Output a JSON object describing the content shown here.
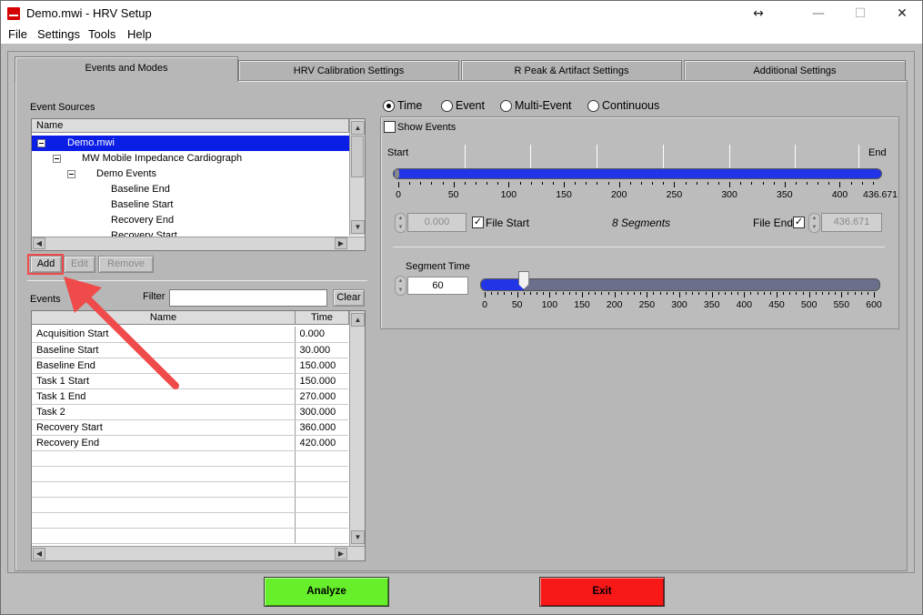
{
  "window": {
    "title": "Demo.mwi - HRV Setup",
    "resize_glyph": "↔",
    "min_glyph": "—",
    "max_glyph": "☐",
    "close_glyph": "✕"
  },
  "menu": [
    "File",
    "Settings",
    "Tools",
    "Help"
  ],
  "tabs": [
    "Events and Modes",
    "HRV Calibration Settings",
    "R Peak & Artifact Settings",
    "Additional Settings"
  ],
  "event_sources": {
    "label": "Event Sources",
    "column": "Name",
    "items": [
      "Demo.mwi",
      "MW Mobile Impedance Cardiograph",
      "Demo Events",
      "Baseline End",
      "Baseline Start",
      "Recovery End",
      "Recovery Start"
    ]
  },
  "source_buttons": {
    "add": "Add",
    "edit": "Edit",
    "remove": "Remove"
  },
  "events": {
    "label": "Events",
    "filter_label": "Filter",
    "filter_value": "",
    "clear": "Clear",
    "columns": [
      "Name",
      "Time"
    ],
    "rows": [
      [
        "Acquisition Start",
        "0.000"
      ],
      [
        "Baseline Start",
        "30.000"
      ],
      [
        "Baseline End",
        "150.000"
      ],
      [
        "Task 1 Start",
        "150.000"
      ],
      [
        "Task 1 End",
        "270.000"
      ],
      [
        "Task 2",
        "300.000"
      ],
      [
        "Recovery Start",
        "360.000"
      ],
      [
        "Recovery End",
        "420.000"
      ],
      [
        "",
        ""
      ],
      [
        "",
        ""
      ],
      [
        "",
        ""
      ],
      [
        "",
        ""
      ],
      [
        "",
        ""
      ],
      [
        "",
        ""
      ]
    ]
  },
  "modes": {
    "options": [
      "Time",
      "Event",
      "Multi-Event",
      "Continuous"
    ],
    "selected": "Time"
  },
  "timeline": {
    "show_events": "Show Events",
    "start": "Start",
    "end": "End",
    "ticks": [
      "0",
      "50",
      "100",
      "150",
      "200",
      "250",
      "300",
      "350",
      "400",
      "436.671"
    ],
    "start_value": "0.000",
    "file_start": "File Start",
    "segments": "8 Segments",
    "file_end": "File End",
    "end_value": "436.671"
  },
  "segment": {
    "label": "Segment Time",
    "value": "60",
    "ticks": [
      "0",
      "50",
      "100",
      "150",
      "200",
      "250",
      "300",
      "350",
      "400",
      "450",
      "500",
      "550",
      "600"
    ],
    "slider_value": 60
  },
  "footer": {
    "analyze": "Analyze",
    "exit": "Exit"
  },
  "colors": {
    "analyze": "#66ef2a",
    "exit": "#f81818",
    "accent": "#0a1ee6",
    "annotation": "#ef4b4b"
  }
}
